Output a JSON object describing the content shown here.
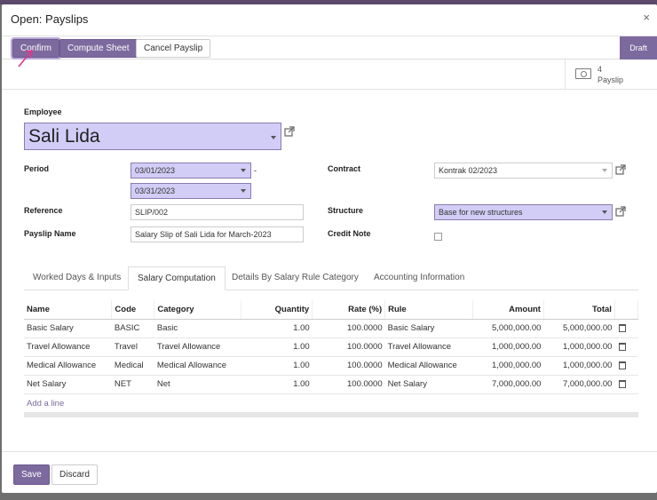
{
  "dialog": {
    "title": "Open: Payslips",
    "close": "×"
  },
  "statusbar": {
    "buttons": [
      "Confirm",
      "Compute Sheet",
      "Cancel Payslip"
    ],
    "state": "Draft"
  },
  "smart_button": {
    "count": "4",
    "label": "Payslip",
    "icon": "payslip-icon"
  },
  "form": {
    "employee_label": "Employee",
    "employee_value": "Sali Lida",
    "period_label": "Period",
    "period_from": "03/01/2023",
    "period_sep": "-",
    "period_to": "03/31/2023",
    "reference_label": "Reference",
    "reference_value": "SLIP/002",
    "payslip_name_label": "Payslip Name",
    "payslip_name_value": "Salary Slip of Sali Lida for March-2023",
    "contract_label": "Contract",
    "contract_value": "Kontrak 02/2023",
    "structure_label": "Structure",
    "structure_value": "Base for new structures",
    "credit_note_label": "Credit Note"
  },
  "tabs": [
    "Worked Days & Inputs",
    "Salary Computation",
    "Details By Salary Rule Category",
    "Accounting Information"
  ],
  "table": {
    "headers": [
      "Name",
      "Code",
      "Category",
      "Quantity",
      "Rate (%)",
      "Rule",
      "Amount",
      "Total"
    ],
    "rows": [
      [
        "Basic Salary",
        "BASIC",
        "Basic",
        "1.00",
        "100.0000",
        "Basic Salary",
        "5,000,000.00",
        "5,000,000.00"
      ],
      [
        "Travel Allowance",
        "Travel",
        "Travel Allowance",
        "1.00",
        "100.0000",
        "Travel Allowance",
        "1,000,000.00",
        "1,000,000.00"
      ],
      [
        "Medical Allowance",
        "Medical",
        "Medical Allowance",
        "1.00",
        "100.0000",
        "Medical Allowance",
        "1,000,000.00",
        "1,000,000.00"
      ],
      [
        "Net Salary",
        "NET",
        "Net",
        "1.00",
        "100.0000",
        "Net Salary",
        "7,000,000.00",
        "7,000,000.00"
      ]
    ],
    "add_line": "Add a line"
  },
  "footer": {
    "save": "Save",
    "discard": "Discard"
  },
  "colors": {
    "primary": "#7c6a9e",
    "required_bg": "#d2cdf6",
    "annotation_arrow": "#e0388a"
  }
}
